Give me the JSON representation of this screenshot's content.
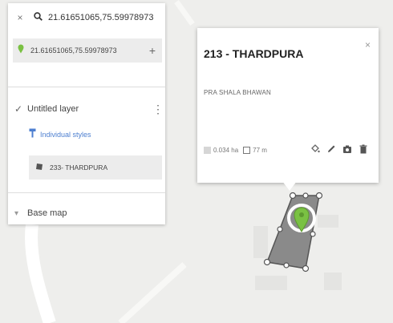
{
  "search": {
    "close_icon": "close-icon",
    "query": "21.61651065,75.59978973"
  },
  "result": {
    "text": "21.61651065,75.59978973",
    "add_label": "+"
  },
  "layer": {
    "checked_mark": "✓",
    "name": "Untitled layer",
    "menu_icon": "⋮",
    "styles_link": "Individual styles",
    "feature_name": "233- THARDPURA"
  },
  "basemap": {
    "label": "Base map"
  },
  "popup": {
    "title": "213 - THARDPURA",
    "close_label": "×",
    "description": "PRA SHALA BHAWAN",
    "area": "0.034 ha",
    "perimeter": "77 m"
  },
  "colors": {
    "pin_green": "#7ac143",
    "polygon_fill": "#8a8a8a",
    "map_background": "#eeeeec",
    "link_blue": "#4d7fd0",
    "panel_highlight": "#ececec"
  }
}
